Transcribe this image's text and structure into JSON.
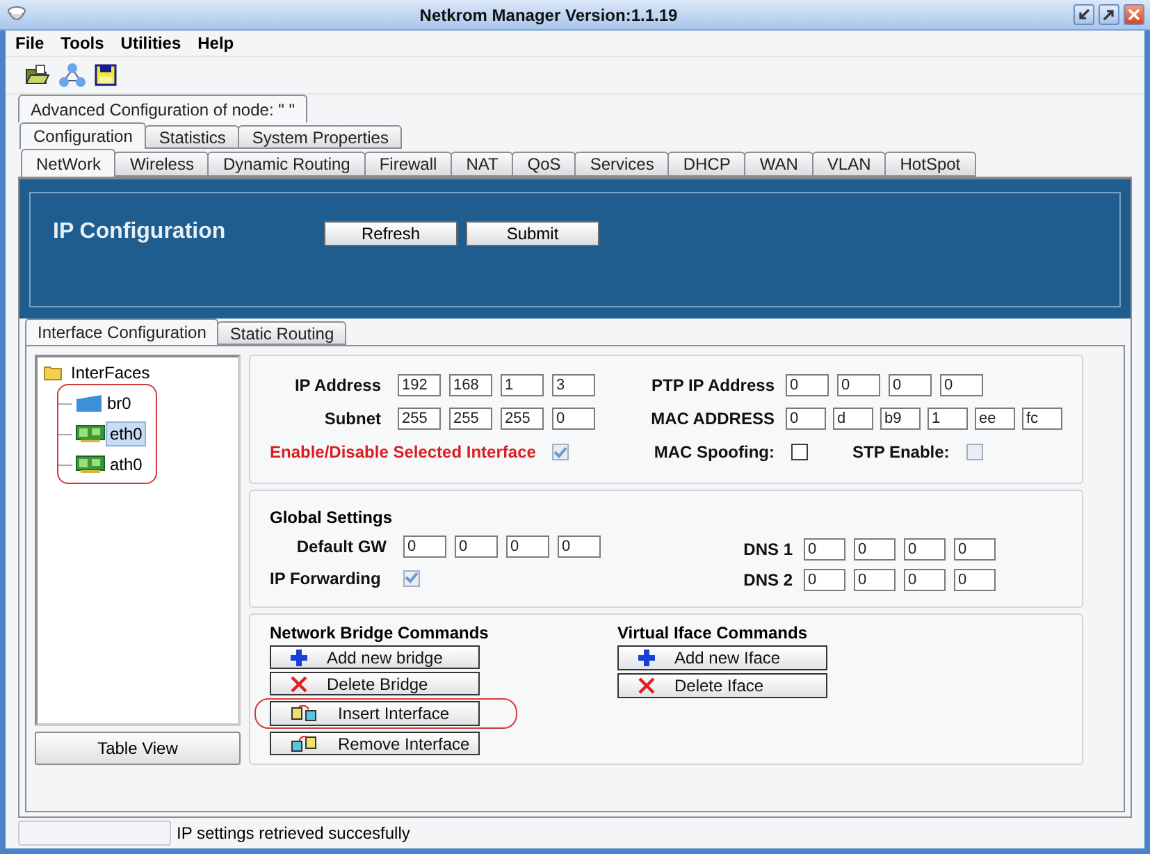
{
  "window": {
    "title": "Netkrom Manager  Version:1.1.19"
  },
  "menu": [
    "File",
    "Tools",
    "Utilities",
    "Help"
  ],
  "node_tabs": [
    {
      "label": "Advanced Configuration of node:  \" \"",
      "selected": true
    }
  ],
  "section_tabs": [
    {
      "label": "Configuration",
      "selected": true
    },
    {
      "label": "Statistics",
      "selected": false
    },
    {
      "label": "System Properties",
      "selected": false
    }
  ],
  "module_tabs": [
    {
      "label": "NetWork",
      "selected": true
    },
    {
      "label": "Wireless",
      "selected": false
    },
    {
      "label": "Dynamic Routing",
      "selected": false
    },
    {
      "label": "Firewall",
      "selected": false
    },
    {
      "label": "NAT",
      "selected": false
    },
    {
      "label": "QoS",
      "selected": false
    },
    {
      "label": "Services",
      "selected": false
    },
    {
      "label": "DHCP",
      "selected": false
    },
    {
      "label": "WAN",
      "selected": false
    },
    {
      "label": "VLAN",
      "selected": false
    },
    {
      "label": "HotSpot",
      "selected": false
    }
  ],
  "banner": {
    "title": "IP Configuration",
    "buttons": [
      "Refresh",
      "Submit"
    ]
  },
  "sub_tabs": [
    {
      "label": "Interface Configuration",
      "selected": true
    },
    {
      "label": "Static Routing",
      "selected": false
    }
  ],
  "tree": {
    "label": "InterFaces",
    "expanded": true,
    "children": [
      {
        "label": "br0",
        "kind": "bridge",
        "selected": false
      },
      {
        "label": "eth0",
        "kind": "nic",
        "selected": true
      },
      {
        "label": "ath0",
        "kind": "nic",
        "selected": false
      }
    ]
  },
  "table_view_button": "Table View",
  "interface": {
    "ip_address": {
      "label": "IP Address",
      "values": [
        "192",
        "168",
        "1",
        "3"
      ]
    },
    "subnet": {
      "label": "Subnet",
      "values": [
        "255",
        "255",
        "255",
        "0"
      ]
    },
    "enable": {
      "label": "Enable/Disable Selected Interface",
      "checked": true,
      "disabled": true
    },
    "ptp_ip_address": {
      "label": "PTP IP Address",
      "values": [
        "0",
        "0",
        "0",
        "0"
      ]
    },
    "mac_address": {
      "label": "MAC ADDRESS",
      "values": [
        "0",
        "d",
        "b9",
        "1",
        "ee",
        "fc"
      ]
    },
    "mac_spoofing": {
      "label": "MAC Spoofing:",
      "checked": false,
      "disabled": false
    },
    "stp_enable": {
      "label": "STP Enable:",
      "checked": false,
      "disabled": true
    }
  },
  "global": {
    "title": "Global Settings",
    "default_gw": {
      "label": "Default GW",
      "values": [
        "0",
        "0",
        "0",
        "0"
      ]
    },
    "ip_forwarding": {
      "label": "IP Forwarding",
      "checked": true,
      "disabled": true
    },
    "dns1": {
      "label": "DNS 1",
      "values": [
        "0",
        "0",
        "0",
        "0"
      ]
    },
    "dns2": {
      "label": "DNS 2",
      "values": [
        "0",
        "0",
        "0",
        "0"
      ]
    }
  },
  "commands": [
    {
      "title": "Network Bridge Commands",
      "buttons": [
        {
          "label": "Add new bridge",
          "kind": "add",
          "highlighted": false
        },
        {
          "label": "Delete Bridge",
          "kind": "delete",
          "highlighted": false
        },
        {
          "label": "Insert Interface",
          "kind": "insert",
          "highlighted": true
        },
        {
          "label": "Remove Interface",
          "kind": "remove",
          "highlighted": false
        }
      ]
    },
    {
      "title": "Virtual Iface Commands",
      "buttons": [
        {
          "label": "Add new Iface",
          "kind": "add",
          "highlighted": false
        },
        {
          "label": "Delete Iface",
          "kind": "delete",
          "highlighted": false
        }
      ]
    }
  ],
  "status_bar": {
    "message": "IP settings retrieved succesfully"
  }
}
